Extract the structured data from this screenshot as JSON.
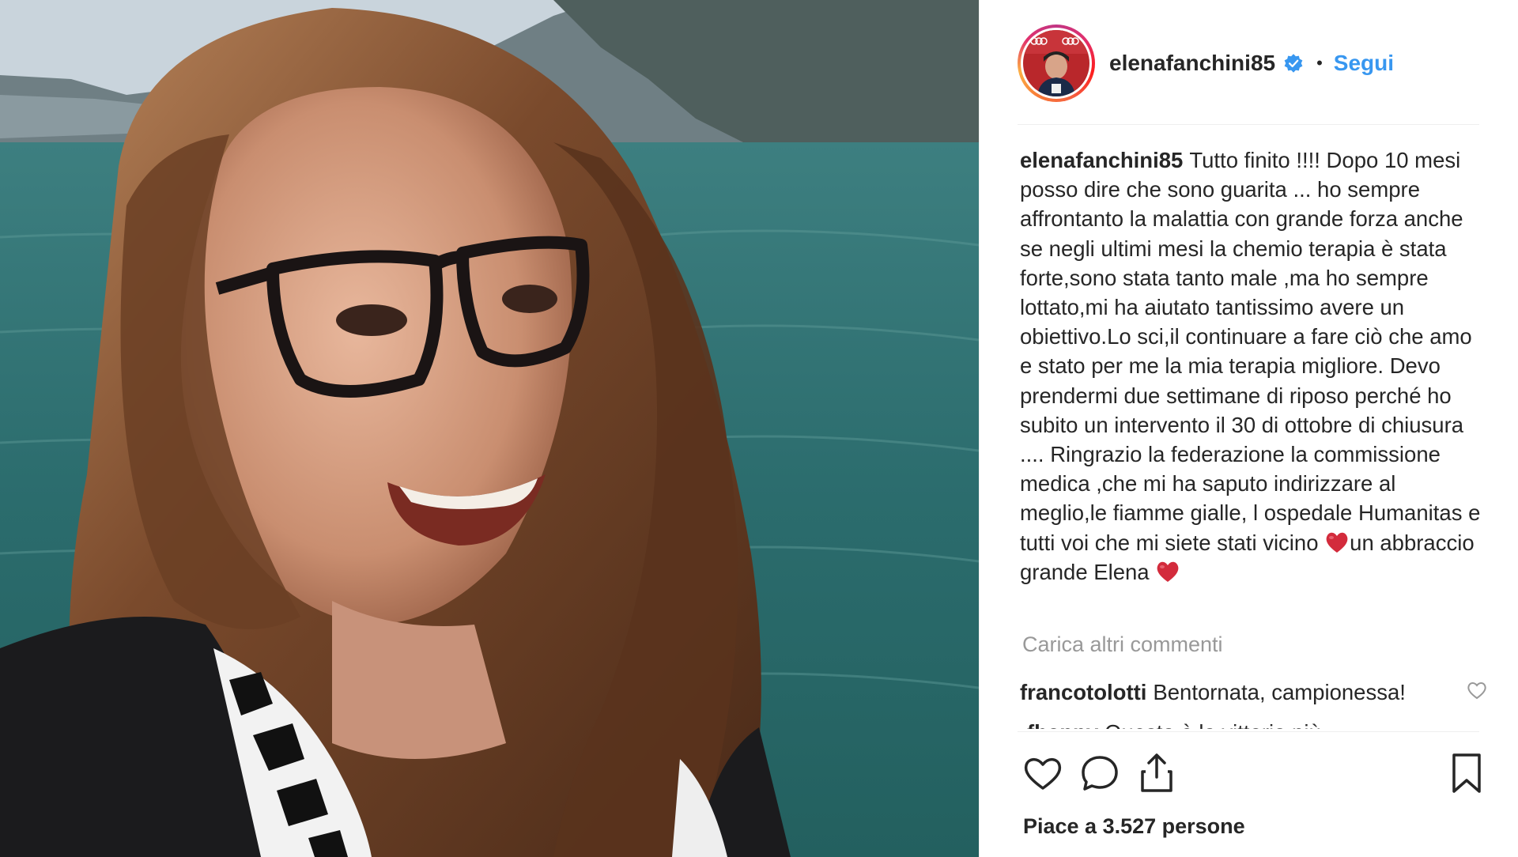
{
  "post": {
    "username": "elenafanchini85",
    "follow_label": "Segui",
    "separator": "•",
    "caption_user": "elenafanchini85",
    "caption_text_1": "Tutto finito !!!! Dopo 10 mesi posso dire che sono guarita ... ho sempre affrontanto la malattia con grande forza anche se negli ultimi mesi la chemio terapia è stata forte,sono stata tanto male ,ma ho sempre lottato,mi ha aiutato tantissimo avere un obiettivo.Lo sci,il continuare a fare ciò che amo e stato per me la mia terapia migliore. Devo prendermi due settimane di riposo perché ho subito un intervento il 30 di ottobre di chiusura .... Ringrazio la federazione la commissione medica ,che mi ha saputo indirizzare al meglio,le fiamme gialle, l ospedale Humanitas e tutti voi che mi siete stati vicino",
    "caption_text_2": "un abbraccio grande Elena",
    "load_more": "Carica altri commenti",
    "comments": [
      {
        "user": "francotolotti",
        "text": "Bentornata, campionessa!"
      },
      {
        "user": "fhappy",
        "text": "Questa è la vittoria più"
      }
    ],
    "likes_text": "Piace a 3.527 persone"
  },
  "icons": {
    "verified": "verified-badge-icon",
    "heart_emoji": "red-heart-emoji",
    "like": "heart-outline-icon",
    "comment": "speech-bubble-icon",
    "share": "share-upload-icon",
    "save": "bookmark-icon"
  },
  "colors": {
    "link": "#3897f0",
    "muted": "#999999",
    "text": "#262626",
    "heart_red": "#d32b3c"
  }
}
